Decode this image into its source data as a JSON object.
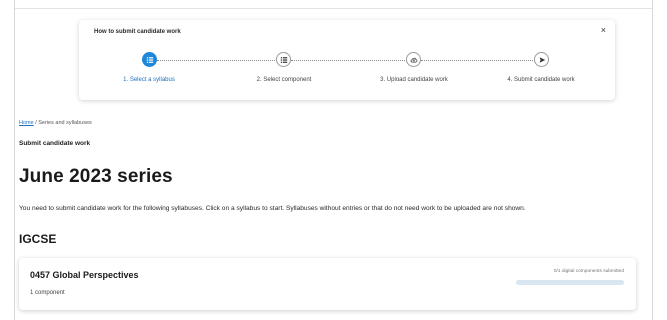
{
  "stepper": {
    "title": "How to submit candidate work",
    "close_label": "×",
    "current_step": 1,
    "steps": [
      {
        "label": "1. Select a syllabus",
        "icon": "list-icon",
        "active": true
      },
      {
        "label": "2. Select component",
        "icon": "list-icon",
        "active": false
      },
      {
        "label": "3. Upload candidate work",
        "icon": "cloud-upload-icon",
        "active": false
      },
      {
        "label": "4. Submit candidate work",
        "icon": "send-icon",
        "active": false
      }
    ]
  },
  "breadcrumb": {
    "home": "Home",
    "separator": "/",
    "current": "Series and syllabuses"
  },
  "page": {
    "subtitle": "Submit candidate work",
    "series_heading": "June 2023 series",
    "instructions": "You need to submit candidate work for the following syllabuses. Click on a syllabus to start. Syllabuses without entries or that do not need work to be uploaded are not shown.",
    "qualification": "IGCSE"
  },
  "syllabuses": [
    {
      "title": "0457 Global Perspectives",
      "components": "1 component",
      "submitted_text": "0/1 digital components submitted",
      "progress_fraction": 0
    }
  ],
  "colors": {
    "accent": "#1f86d8",
    "link": "#1f6fc0",
    "progress_track": "#d9e6f2"
  }
}
